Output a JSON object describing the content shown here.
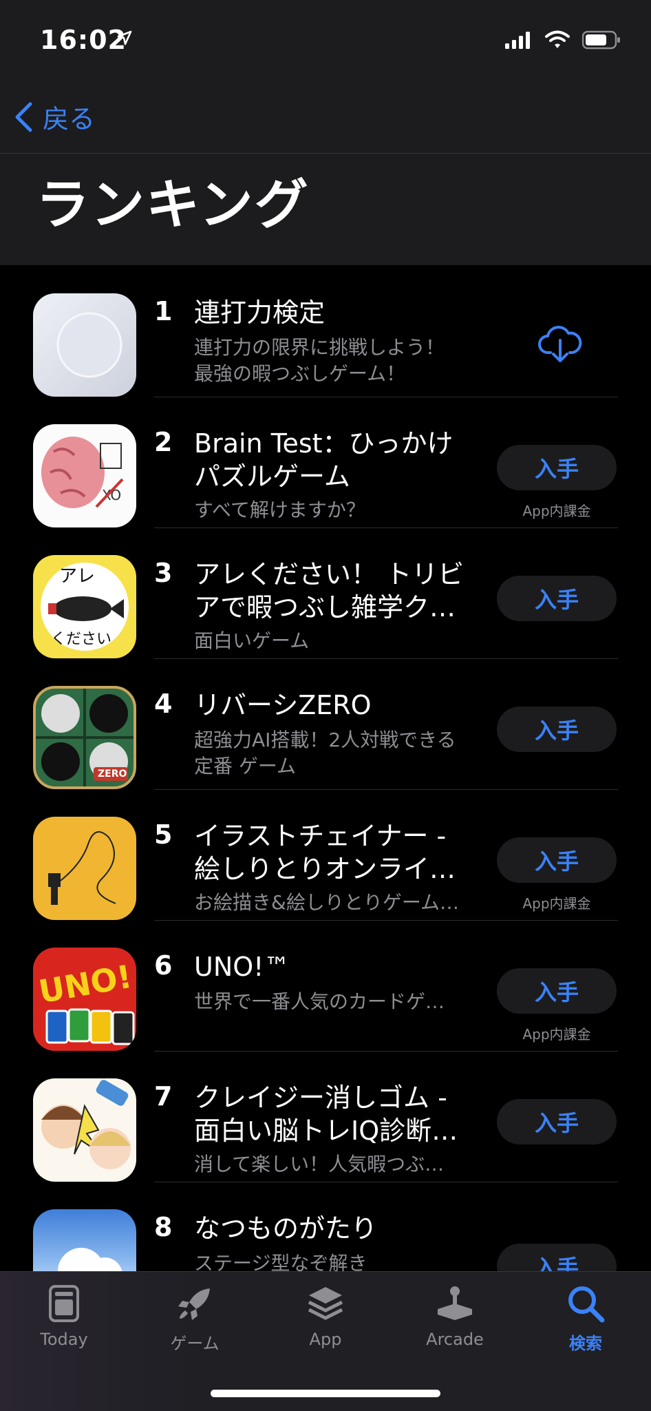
{
  "status": {
    "time": "16:02"
  },
  "nav": {
    "back_label": "戻る"
  },
  "page": {
    "title": "ランキング"
  },
  "items": [
    {
      "rank": "1",
      "name": "連打力検定",
      "subtitle": "連打力の限界に挑戦しよう！\n最強の暇つぶしゲーム！",
      "action": "download-cloud"
    },
    {
      "rank": "2",
      "name": "Brain Test：ひっかけ\nパズルゲーム",
      "subtitle": "すべて解けますか？",
      "action": "入手",
      "iap": "App内課金"
    },
    {
      "rank": "3",
      "name": "アレください！ トリビ\nアで暇つぶし雑学ク…",
      "subtitle": "面白いゲーム",
      "action": "入手"
    },
    {
      "rank": "4",
      "name": "リバーシZERO",
      "subtitle": "超強力AI搭載！2人対戦できる\n定番 ゲーム",
      "action": "入手"
    },
    {
      "rank": "5",
      "name": "イラストチェイナー -\n絵しりとりオンライ…",
      "subtitle": "お絵描き&絵しりとりゲーム…",
      "action": "入手",
      "iap": "App内課金"
    },
    {
      "rank": "6",
      "name": "UNO!™",
      "subtitle": "世界で一番人気のカードゲ…",
      "action": "入手",
      "iap": "App内課金"
    },
    {
      "rank": "7",
      "name": "クレイジー消しゴム -\n面白い脳トレIQ診断…",
      "subtitle": "消して楽しい！人気暇つぶ…",
      "action": "入手"
    },
    {
      "rank": "8",
      "name": "なつものがたり",
      "subtitle": "ステージ型なぞ解き",
      "action": "入手"
    }
  ],
  "icon_labels": {
    "reversi_badge": "ZERO",
    "uno_logo": "UNO!",
    "are_text_top": "アレ",
    "are_text_bottom": "ください"
  },
  "tabs": [
    {
      "label": "Today",
      "icon": "today-icon",
      "active": false
    },
    {
      "label": "ゲーム",
      "icon": "rocket-icon",
      "active": false
    },
    {
      "label": "App",
      "icon": "layers-icon",
      "active": false
    },
    {
      "label": "Arcade",
      "icon": "joystick-icon",
      "active": false
    },
    {
      "label": "検索",
      "icon": "search-icon",
      "active": true
    }
  ],
  "colors": {
    "accent": "#3a82f7",
    "background": "#000000",
    "bar": "#1c1c1e"
  }
}
